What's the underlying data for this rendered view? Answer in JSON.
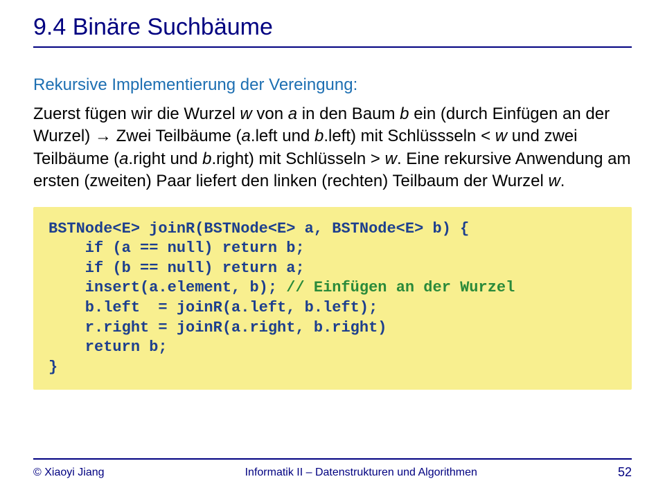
{
  "heading": "9.4 Binäre Suchbäume",
  "subtitle": "Rekursive Implementierung der Vereingung:",
  "para": {
    "t1": "Zuerst fügen wir die Wurzel ",
    "w": "w",
    "t2": " von ",
    "a": "a",
    "t3": " in den Baum ",
    "b": "b",
    "t4": " ein (durch Einfügen an der Wurzel) ",
    "arrow": "→",
    "t5": " Zwei Teilbäume (",
    "aleft": "a",
    "t6": ".left und ",
    "bleft": "b",
    "t7": ".left) mit Schlüssseln < ",
    "w2": "w",
    "t8": " und zwei Teilbäume (",
    "aright": "a",
    "t9": ".right und ",
    "bright": "b",
    "t10": ".right) mit Schlüsseln > ",
    "w3": "w",
    "t11": ". Eine rekursive Anwendung am ersten (zweiten) Paar liefert den linken (rechten) Teilbaum der Wurzel ",
    "w4": "w",
    "t12": "."
  },
  "code": {
    "l1": "BSTNode<E> joinR(BSTNode<E> a, BSTNode<E> b) {",
    "l2": "    if (a == null) return b;",
    "l3": "    if (b == null) return a;",
    "l4a": "    insert(a.element, b); ",
    "l4b": "// Einfügen an der Wurzel",
    "l5": "    b.left  = joinR(a.left, b.left);",
    "l6": "    r.right = joinR(a.right, b.right)",
    "l7": "    return b;",
    "l8": "}"
  },
  "footer": {
    "author": "© Xiaoyi Jiang",
    "title": "Informatik II – Datenstrukturen und Algorithmen",
    "page": "52"
  }
}
